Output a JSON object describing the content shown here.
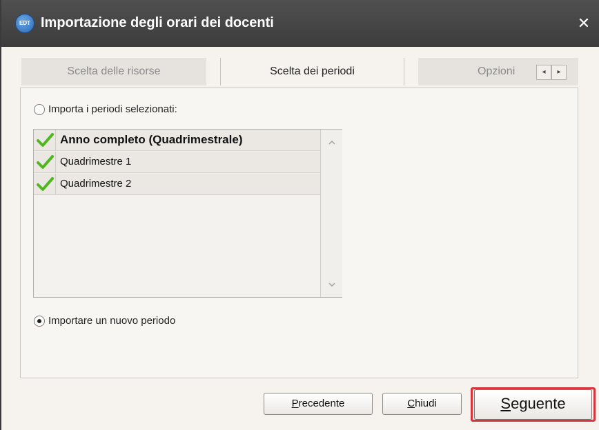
{
  "window": {
    "title": "Importazione degli orari dei docenti",
    "app_icon_text": "EDT",
    "close_symbol": "✕"
  },
  "tabs": [
    {
      "label": "Scelta delle risorse",
      "active": false
    },
    {
      "label": "Scelta dei periodi",
      "active": true
    },
    {
      "label": "Opzioni",
      "active": false
    }
  ],
  "tab_scroll": {
    "left": "◂",
    "right": "▸"
  },
  "options": {
    "import_selected": {
      "label": "Importa i periodi selezionati:",
      "checked": false
    },
    "import_new": {
      "label": "Importare un nuovo periodo",
      "checked": true
    }
  },
  "periods": [
    {
      "label": "Anno completo (Quadrimestrale)",
      "checked": true,
      "bold": true
    },
    {
      "label": "Quadrimestre 1",
      "checked": true,
      "bold": false
    },
    {
      "label": "Quadrimestre 2",
      "checked": true,
      "bold": false
    }
  ],
  "buttons": {
    "prev": {
      "mnemonic": "P",
      "rest": "recedente"
    },
    "close": {
      "mnemonic": "C",
      "rest": "hiudi"
    },
    "next": {
      "mnemonic": "S",
      "rest": "eguente"
    }
  },
  "colors": {
    "check": "#4fb81e",
    "highlight": "#d8343c",
    "titlebar": "#444444"
  }
}
